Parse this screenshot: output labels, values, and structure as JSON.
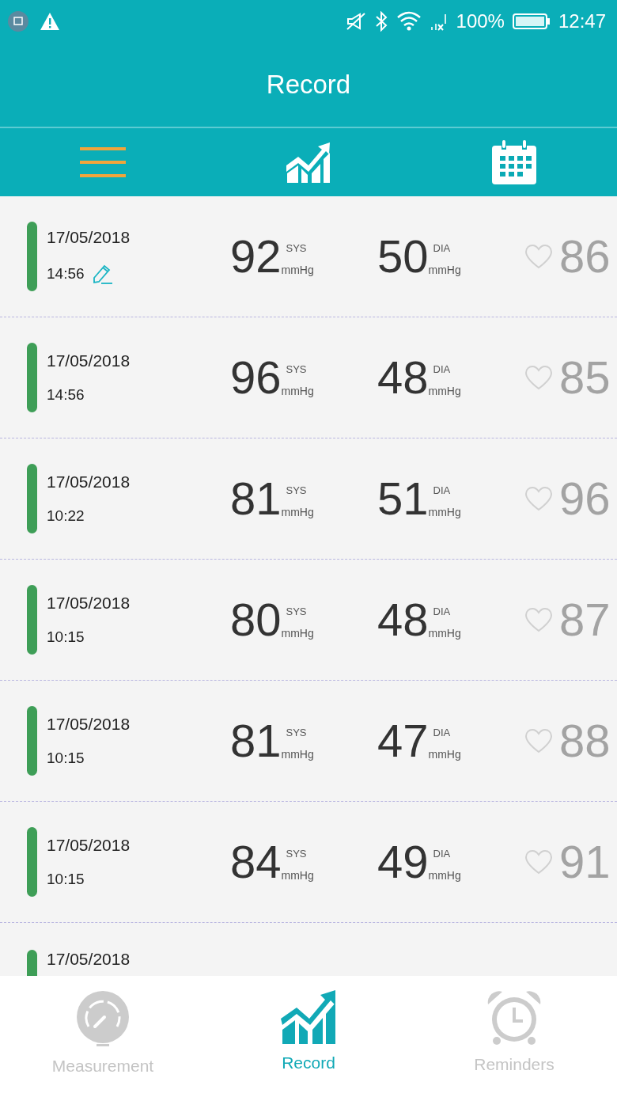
{
  "status_bar": {
    "battery": "100%",
    "time": "12:47"
  },
  "header": {
    "title": "Record"
  },
  "views": [
    {
      "kind": "list",
      "selected": true
    },
    {
      "kind": "chart",
      "selected": false
    },
    {
      "kind": "calendar",
      "selected": false
    }
  ],
  "records": [
    {
      "date": "17/05/2018",
      "time": "14:56",
      "edited": true,
      "color": "#3e9e57",
      "sys": "92",
      "sys_label": "SYS",
      "sys_unit": "mmHg",
      "dia": "50",
      "dia_label": "DIA",
      "dia_unit": "mmHg",
      "pulse": "86"
    },
    {
      "date": "17/05/2018",
      "time": "14:56",
      "edited": false,
      "color": "#3e9e57",
      "sys": "96",
      "sys_label": "SYS",
      "sys_unit": "mmHg",
      "dia": "48",
      "dia_label": "DIA",
      "dia_unit": "mmHg",
      "pulse": "85"
    },
    {
      "date": "17/05/2018",
      "time": "10:22",
      "edited": false,
      "color": "#3e9e57",
      "sys": "81",
      "sys_label": "SYS",
      "sys_unit": "mmHg",
      "dia": "51",
      "dia_label": "DIA",
      "dia_unit": "mmHg",
      "pulse": "96"
    },
    {
      "date": "17/05/2018",
      "time": "10:15",
      "edited": false,
      "color": "#3e9e57",
      "sys": "80",
      "sys_label": "SYS",
      "sys_unit": "mmHg",
      "dia": "48",
      "dia_label": "DIA",
      "dia_unit": "mmHg",
      "pulse": "87"
    },
    {
      "date": "17/05/2018",
      "time": "10:15",
      "edited": false,
      "color": "#3e9e57",
      "sys": "81",
      "sys_label": "SYS",
      "sys_unit": "mmHg",
      "dia": "47",
      "dia_label": "DIA",
      "dia_unit": "mmHg",
      "pulse": "88"
    },
    {
      "date": "17/05/2018",
      "time": "10:15",
      "edited": false,
      "color": "#3e9e57",
      "sys": "84",
      "sys_label": "SYS",
      "sys_unit": "mmHg",
      "dia": "49",
      "dia_label": "DIA",
      "dia_unit": "mmHg",
      "pulse": "91"
    },
    {
      "date": "17/05/2018",
      "color": "#3e9e57"
    }
  ],
  "bottom_nav": [
    {
      "kind": "measurement",
      "label": "Measurement",
      "selected": false
    },
    {
      "kind": "record",
      "label": "Record",
      "selected": true
    },
    {
      "kind": "reminders",
      "label": "Reminders",
      "selected": false
    }
  ]
}
